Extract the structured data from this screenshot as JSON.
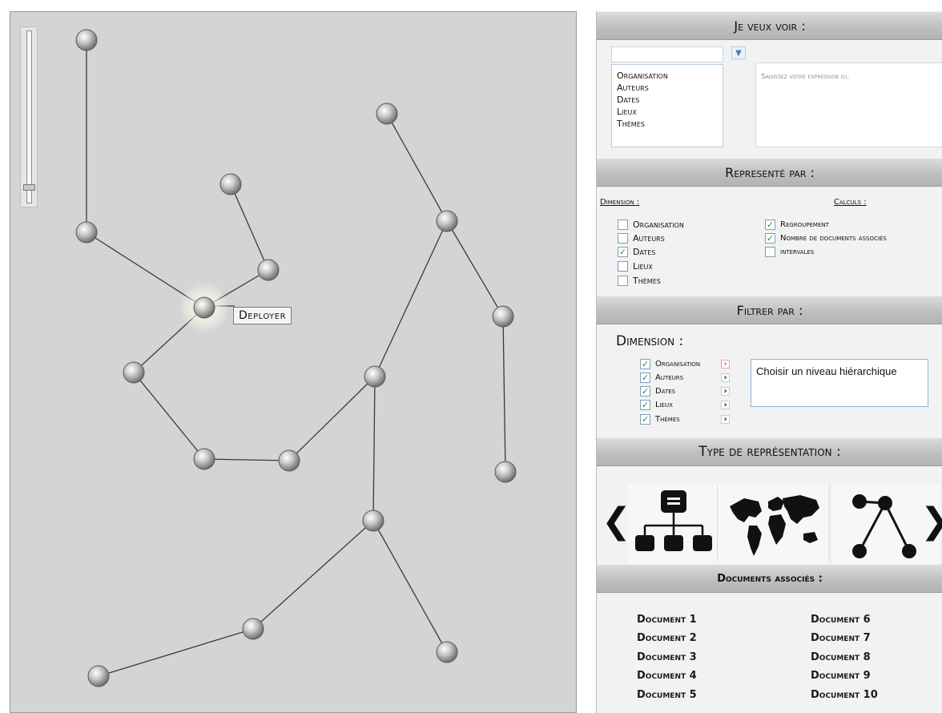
{
  "graph": {
    "tooltip": "Deployer"
  },
  "je_veux_voir": {
    "header": "Je veux voir :",
    "dimension_select_value": "",
    "options": [
      "Organisation",
      "Auteurs",
      "Dates",
      "Lieux",
      "Thèmes"
    ],
    "expression_placeholder": "Saisissez votre expression ici."
  },
  "represente_par": {
    "header": "Representé par :",
    "dimension_label": "Dimension :",
    "calculs_label": "Calculs :",
    "dimensions": [
      {
        "label": "Organisation",
        "checked": false
      },
      {
        "label": "Auteurs",
        "checked": false
      },
      {
        "label": "Dates",
        "checked": true
      },
      {
        "label": "Lieux",
        "checked": false
      },
      {
        "label": "Thèmes",
        "checked": false
      }
    ],
    "calculs": [
      {
        "label": "Regroupement",
        "checked": true
      },
      {
        "label": "Nombre de documents associés",
        "checked": true
      },
      {
        "label": "intervales",
        "checked": false
      }
    ]
  },
  "filtrer_par": {
    "header": "Filtrer par :",
    "dimension_label": "Dimension :",
    "items": [
      {
        "label": "Organisation",
        "checked": true,
        "active": true
      },
      {
        "label": "Auteurs",
        "checked": true,
        "active": false
      },
      {
        "label": "Dates",
        "checked": true,
        "active": false
      },
      {
        "label": "Lieux",
        "checked": true,
        "active": false
      },
      {
        "label": "Thèmes",
        "checked": true,
        "active": false
      }
    ],
    "hierarchy_text": "Choisir un niveau hiérarchique"
  },
  "type_representation": {
    "header": "Type de représentation :",
    "options": [
      "hierarchy-icon",
      "world-map-icon",
      "node-graph-icon"
    ],
    "prev": "‹",
    "next": "›"
  },
  "documents": {
    "header": "Documents associés :",
    "items": [
      "Document 1",
      "Document 2",
      "Document 3",
      "Document 4",
      "Document 5",
      "Document 6",
      "Document 7",
      "Document 8",
      "Document 9",
      "Document 10"
    ]
  },
  "colors": {
    "panel_bg": "#d4d4d4",
    "check_green": "#2e8b2e",
    "active_arrow": "#d9534f"
  }
}
